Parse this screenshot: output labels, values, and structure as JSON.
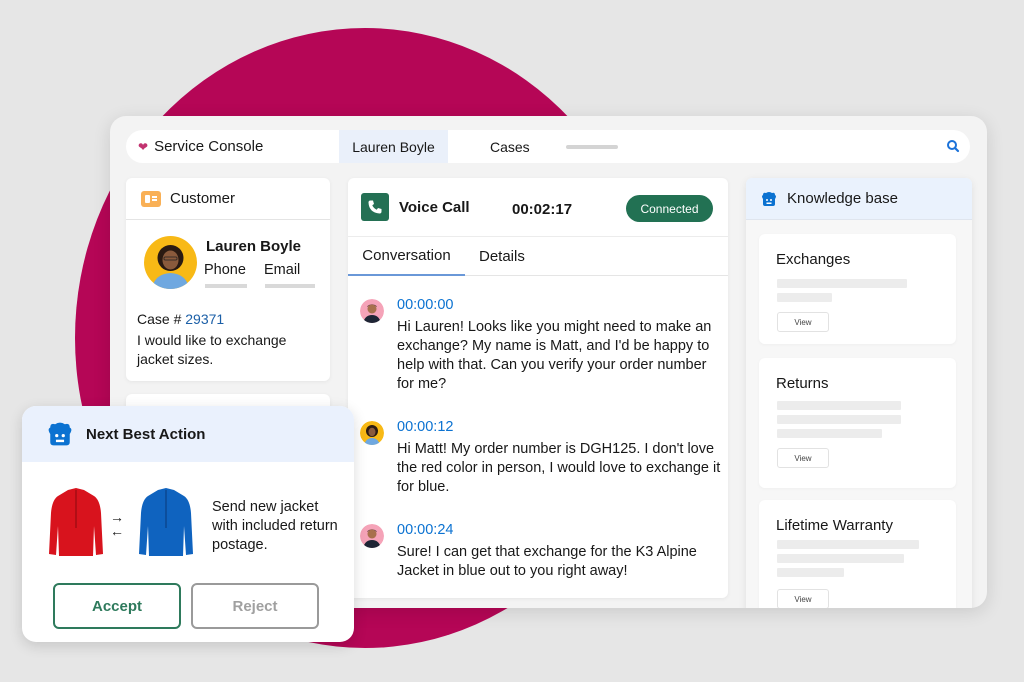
{
  "colors": {
    "background": "#e6e6e6",
    "accent_circle": "#b50656",
    "brand_green": "#227153",
    "link_blue": "#0b72d1",
    "case_blue": "#1b5fa7",
    "astro_blue": "#0b72d1"
  },
  "topbar": {
    "app_name": "Service Console",
    "app_icon": "heart-icon",
    "tabs": [
      {
        "label": "Lauren Boyle",
        "active": true
      },
      {
        "label": "Cases",
        "active": false
      }
    ],
    "search_icon": "search-icon"
  },
  "customer": {
    "title": "Customer",
    "icon": "contact-card-icon",
    "name": "Lauren Boyle",
    "phone_label": "Phone",
    "email_label": "Email",
    "case_prefix": "Case # ",
    "case_number": "29371",
    "case_description": "I would like to exchange jacket sizes."
  },
  "voice_call": {
    "title": "Voice Call",
    "icon": "phone-icon",
    "timer": "00:02:17",
    "status": "Connected",
    "tabs": [
      {
        "label": "Conversation",
        "active": true
      },
      {
        "label": "Details",
        "active": false
      }
    ],
    "messages": [
      {
        "speaker": "Matt",
        "time": "00:00:00",
        "text": "Hi Lauren! Looks like you might need to make an exchange? My name is Matt, and I'd be happy to help with that. Can you verify your order number for me?"
      },
      {
        "speaker": "Lauren",
        "time": "00:00:12",
        "text": "Hi Matt! My order number is DGH125. I don't love the red color in person, I would love to exchange it for blue."
      },
      {
        "speaker": "Matt",
        "time": "00:00:24",
        "text": "Sure! I can get that exchange for the K3 Alpine Jacket in blue out to you right away!"
      }
    ]
  },
  "knowledge_base": {
    "title": "Knowledge base",
    "icon": "astro-icon",
    "articles": [
      {
        "title": "Exchanges",
        "button": "View"
      },
      {
        "title": "Returns",
        "button": "View"
      },
      {
        "title": "Lifetime Warranty",
        "button": "View"
      }
    ]
  },
  "next_best_action": {
    "title": "Next Best Action",
    "icon": "astro-icon",
    "swap_symbol_top": "→",
    "swap_symbol_bottom": "←",
    "description": "Send new jacket with included return postage.",
    "accept_label": "Accept",
    "reject_label": "Reject"
  }
}
